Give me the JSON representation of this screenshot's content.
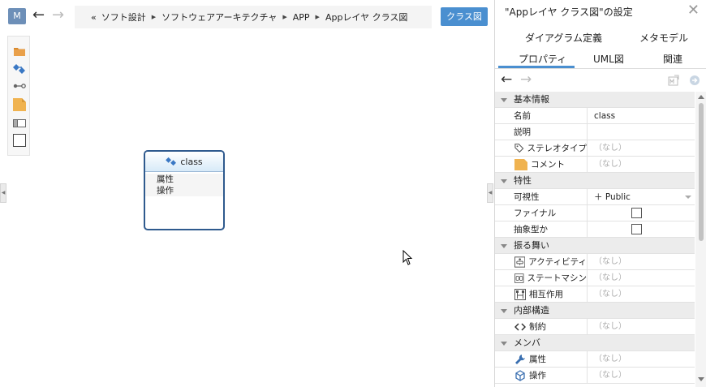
{
  "header": {
    "badge": "M",
    "breadcrumb": {
      "prefix": "«",
      "items": [
        "ソフト設計",
        "ソフトウェアアーキテクチャ",
        "APP",
        "Appレイヤ クラス図"
      ]
    },
    "diagram_button": "クラス図"
  },
  "palette": {
    "items": [
      "folder-icon",
      "class-icon",
      "association-icon",
      "note-icon",
      "frame-icon",
      "rectangle-icon"
    ]
  },
  "canvas": {
    "class_box": {
      "name": "class",
      "sections": [
        "属性",
        "操作"
      ]
    }
  },
  "panel": {
    "title": "\"Appレイヤ クラス図\"の設定",
    "tabs_row1": [
      "ダイアグラム定義",
      "メタモデル"
    ],
    "tabs_row2": [
      "プロパティ",
      "UML図",
      "関連"
    ],
    "active_tab": "プロパティ",
    "basic": {
      "section": "基本情報",
      "name_label": "名前",
      "name_value": "class",
      "desc_label": "説明",
      "stereotype_label": "ステレオタイプ",
      "stereotype_value": "（なし）",
      "comment_label": "コメント",
      "comment_value": "（なし）"
    },
    "features": {
      "section": "特性",
      "visibility_label": "可視性",
      "visibility_value": "＋ Public",
      "final_label": "ファイナル",
      "abstract_label": "抽象型か"
    },
    "behavior": {
      "section": "振る舞い",
      "activity_label": "アクティビティ",
      "activity_value": "（なし）",
      "statemachine_label": "ステートマシン",
      "statemachine_value": "（なし）",
      "interaction_label": "相互作用",
      "interaction_value": "（なし）"
    },
    "internal": {
      "section": "内部構造",
      "constraint_label": "制約",
      "constraint_value": "（なし）"
    },
    "member": {
      "section": "メンバ",
      "attribute_label": "属性",
      "attribute_value": "（なし）",
      "operation_label": "操作",
      "operation_value": "（なし）"
    }
  },
  "colors": {
    "accent": "#4a8fd0",
    "class_border": "#2f5a8e",
    "badge": "#6d8fb8"
  }
}
